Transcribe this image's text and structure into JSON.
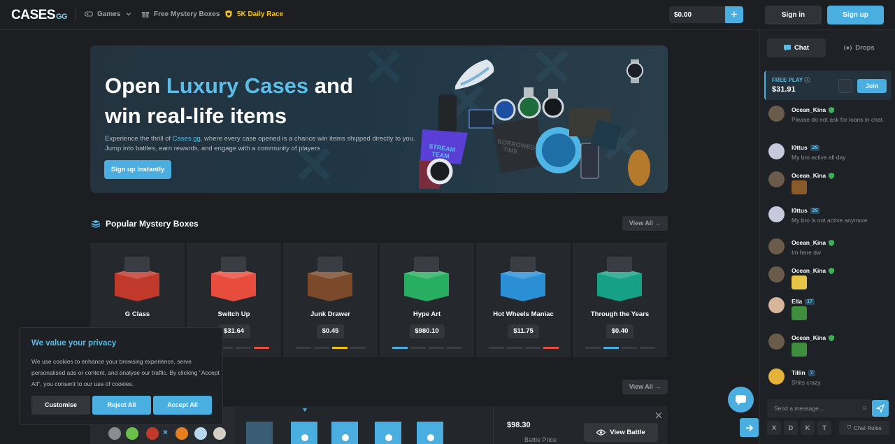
{
  "brand": {
    "logo_main": "CASES",
    "logo_sub": "GG"
  },
  "nav": {
    "games": "Games",
    "mystery_boxes": "Free Mystery Boxes",
    "race": "5K Daily Race"
  },
  "account": {
    "balance": "$0.00",
    "deposit_icon": "+",
    "signin": "Sign in",
    "signup": "Sign up"
  },
  "hero": {
    "title_1": "Open ",
    "title_accent": "Luxury Cases",
    "title_2": " and",
    "title_3": "win real-life items",
    "desc_1": "Experience the thrill of ",
    "desc_link": "Cases.gg",
    "desc_2": ", where every case opened is a chance win items shipped directly to you. Jump into battles, earn rewards, and engage with a community of players",
    "cta": "Sign up instantly"
  },
  "sections": {
    "popular_title": "Popular Mystery Boxes",
    "view_all": "View All"
  },
  "boxes": [
    {
      "name": "G Class",
      "price": "",
      "bar_color": "#888888",
      "color": "#c0392b"
    },
    {
      "name": "Switch Up",
      "price": "$31.64",
      "bar_color": "#e74c3c",
      "color": "#e74c3c"
    },
    {
      "name": "Junk Drawer",
      "price": "$0.45",
      "bar_color": "#f1c40f",
      "color": "#7b4a2a"
    },
    {
      "name": "Hype Art",
      "price": "$980.10",
      "bar_color": "#4aaee0",
      "color": "#27ae60"
    },
    {
      "name": "Hot Wheels Maniac",
      "price": "$11.75",
      "bar_color": "#e74c3c",
      "color": "#2b8fd6"
    },
    {
      "name": "Through the Years",
      "price": "$0.40",
      "bar_color": "#4aaee0",
      "color": "#16a085"
    }
  ],
  "battle": {
    "price": "$98.30",
    "price_label": "Battle Price",
    "view_button": "View Battle",
    "vs": "×"
  },
  "cookie": {
    "title": "We value your privacy",
    "body": "We use cookies to enhance your browsing experience, serve personalised ads or content, and analyse our traffic. By clicking \"Accept All\", you consent to our use of cookies.",
    "customise": "Customise",
    "reject": "Reject All",
    "accept": "Accept All"
  },
  "panel": {
    "tab_chat": "Chat",
    "tab_drops": "Drops",
    "freeplay_label": "FREE PLAY",
    "freeplay_amount": "$31.91",
    "join": "Join",
    "input_placeholder": "Send a message...",
    "chat_rules": "Chat Rules",
    "social": [
      "X",
      "D",
      "K",
      "T"
    ]
  },
  "messages": [
    {
      "user": "Ocean_Kina",
      "level": "",
      "mod": true,
      "text": "Please do not ask for loans in chat.",
      "emote": false,
      "avatar": "#6b5b4b"
    },
    {
      "user": "l0ttus",
      "level": "29",
      "mod": false,
      "text": "My bro active all day",
      "emote": false,
      "avatar": "#c7c9dc"
    },
    {
      "user": "Ocean_Kina",
      "level": "",
      "mod": true,
      "text": "",
      "emote": true,
      "emote_color": "#8a5a2b",
      "avatar": "#6b5b4b"
    },
    {
      "user": "l0ttus",
      "level": "29",
      "mod": false,
      "text": "My bro is not active anymore",
      "emote": false,
      "avatar": "#c7c9dc"
    },
    {
      "user": "Ocean_Kina",
      "level": "",
      "mod": true,
      "text": "Im here dw",
      "emote": false,
      "avatar": "#6b5b4b"
    },
    {
      "user": "Ocean_Kina",
      "level": "",
      "mod": true,
      "text": "",
      "emote": true,
      "emote_color": "#e8c547",
      "avatar": "#6b5b4b"
    },
    {
      "user": "Ella",
      "level": "17",
      "mod": false,
      "text": "",
      "emote": true,
      "emote_color": "#3e8e3e",
      "avatar": "#d6b59a"
    },
    {
      "user": "Ocean_Kina",
      "level": "",
      "mod": true,
      "text": "",
      "emote": true,
      "emote_color": "#3e8e3e",
      "avatar": "#6b5b4b"
    },
    {
      "user": "Tillin",
      "level": "7",
      "mod": false,
      "text": "Shits crazy",
      "emote": false,
      "avatar": "#e6b33a"
    }
  ]
}
